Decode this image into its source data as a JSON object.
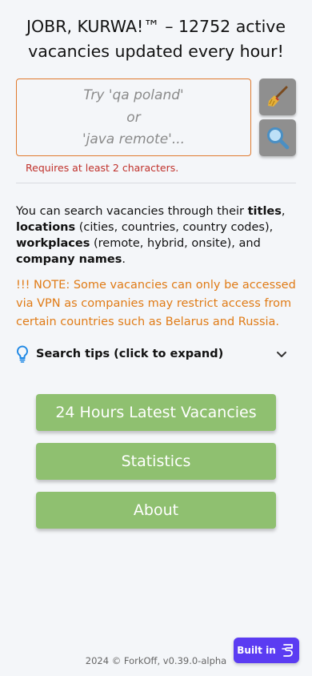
{
  "header": {
    "title": "JOBR, KURWA!™ – 12752 active vacancies updated every hour!"
  },
  "search": {
    "placeholder_lines": [
      "Try 'qa poland'",
      "or",
      "'java remote'..."
    ],
    "error": "Requires at least 2 characters.",
    "clear_icon": "broom-icon",
    "search_icon": "magnifier-icon"
  },
  "description": {
    "p1": "You can search vacancies through their ",
    "titles": "titles",
    "p2": ", ",
    "locations": "locations",
    "p3": " (cities, countries, country codes), ",
    "workplaces": "workplaces",
    "p4": " (remote, hybrid, onsite), and ",
    "company_names": "company names",
    "p5": "."
  },
  "note": "!!! NOTE: Some vacancies can only be accessed via VPN as companies may restrict access from certain countries such as Belarus and Russia.",
  "tips": {
    "label": "Search tips (click to expand)"
  },
  "nav": {
    "latest": "24 Hours Latest Vacancies",
    "statistics": "Statistics",
    "about": "About"
  },
  "footer": {
    "text": "2024 © ForkOff, v0.39.0-alpha"
  },
  "badge": {
    "label": "Built in"
  },
  "colors": {
    "accent_orange": "#e07b16",
    "error_red": "#c0312b",
    "nav_green": "#8fc070",
    "badge_purple": "#5b3cf2"
  }
}
